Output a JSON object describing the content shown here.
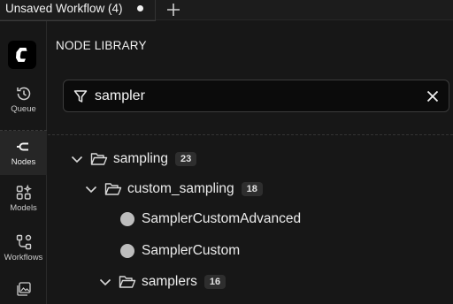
{
  "tab": {
    "title": "Unsaved Workflow (4)",
    "unsaved_indicator": "●",
    "new_tab_icon": "plus-icon"
  },
  "sidebar": {
    "logo_icon": "comfy-logo-icon",
    "items": [
      {
        "label": "Queue",
        "icon": "history-icon",
        "active": false
      },
      {
        "label": "Nodes",
        "icon": "node-connect-icon",
        "active": true
      },
      {
        "label": "Models",
        "icon": "models-icon",
        "active": false
      },
      {
        "label": "Workflows",
        "icon": "workflows-icon",
        "active": false
      },
      {
        "label": "",
        "icon": "image-gallery-icon",
        "active": false
      }
    ]
  },
  "panel": {
    "title": "NODE LIBRARY",
    "search": {
      "value": "sampler",
      "placeholder": "",
      "filter_icon": "filter-icon",
      "clear_icon": "close-icon"
    }
  },
  "tree": [
    {
      "label": "sampling",
      "count": "23",
      "type": "folder",
      "expanded": true,
      "depth": 0
    },
    {
      "label": "custom_sampling",
      "count": "18",
      "type": "folder",
      "expanded": true,
      "depth": 1
    },
    {
      "label": "SamplerCustomAdvanced",
      "type": "node",
      "depth": 2
    },
    {
      "label": "SamplerCustom",
      "type": "node",
      "depth": 2
    },
    {
      "label": "samplers",
      "count": "16",
      "type": "folder",
      "expanded": true,
      "depth": 2
    }
  ],
  "colors": {
    "background": "#171717",
    "badge": "#2e2e2e",
    "node_dot": "#bdbdbd",
    "active_item": "#262626"
  }
}
